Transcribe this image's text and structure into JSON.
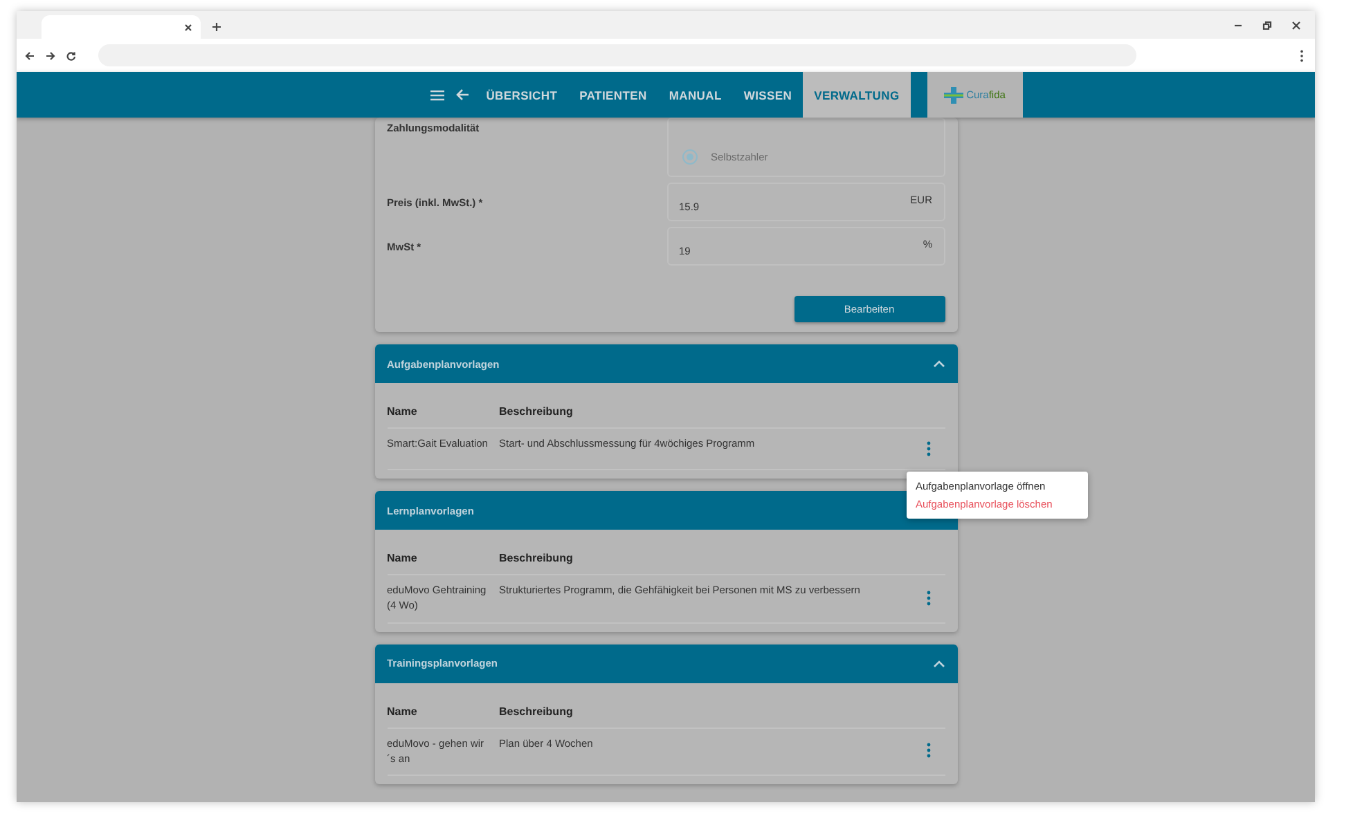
{
  "nav": {
    "items": [
      {
        "label": "ÜBERSICHT",
        "selected": false
      },
      {
        "label": "PATIENTEN",
        "selected": false
      },
      {
        "label": "MANUAL",
        "selected": false
      },
      {
        "label": "WISSEN",
        "selected": false
      },
      {
        "label": "VERWALTUNG",
        "selected": true
      }
    ],
    "logo": {
      "part_1": "Cura",
      "part_2": "fida"
    }
  },
  "payment_card": {
    "payment_label": "Zahlungsmodalität",
    "payment_options": [
      {
        "label": "Selbstzahler",
        "selected": true
      }
    ],
    "fields": [
      {
        "label": "Preis (inkl. MwSt.) *",
        "value": "15.9",
        "unit": "EUR"
      },
      {
        "label": "MwSt *",
        "value": "19",
        "unit": "%"
      }
    ],
    "button": "Bearbeiten"
  },
  "sections": [
    {
      "title": "Aufgabenplanvorlagen",
      "expanded": true,
      "columns": [
        "Name",
        "Beschreibung"
      ],
      "rows": [
        {
          "name": "Smart:Gait Evaluation",
          "description": "Start- und Abschlussmessung für 4wöchiges Programm",
          "menu_open": true
        }
      ]
    },
    {
      "title": "Lernplanvorlagen",
      "expanded": true,
      "columns": [
        "Name",
        "Beschreibung"
      ],
      "rows": [
        {
          "name": "eduMovo Gehtraining (4 Wo)",
          "description": "Strukturiertes Programm, die Gehfähigkeit bei Personen mit MS zu verbessern",
          "menu_open": false
        }
      ]
    },
    {
      "title": "Trainingsplanvorlagen",
      "expanded": true,
      "columns": [
        "Name",
        "Beschreibung"
      ],
      "rows": [
        {
          "name": "eduMovo - gehen wir ´s an",
          "description": "Plan über 4 Wochen",
          "menu_open": false
        }
      ]
    }
  ],
  "context_menu": {
    "items": [
      {
        "label": "Aufgabenplanvorlage öffnen",
        "kind": "normal"
      },
      {
        "label": "Aufgabenplanvorlage löschen",
        "kind": "danger"
      }
    ]
  }
}
